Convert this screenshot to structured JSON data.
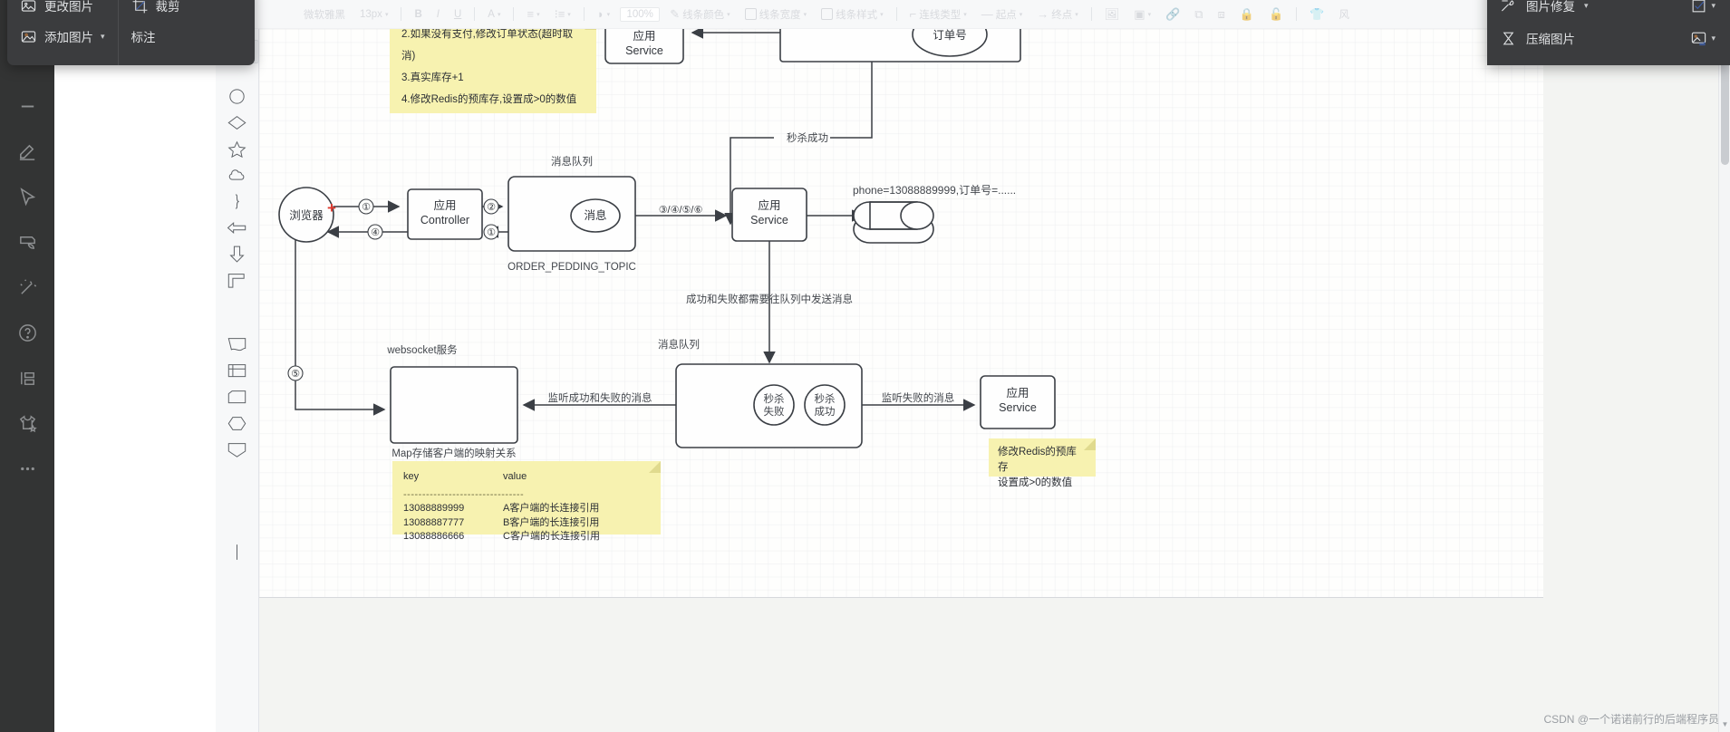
{
  "toolbar": {
    "font_name": "微软雅黑",
    "font_size": "13px",
    "bold": "B",
    "italic": "I",
    "underline": "U",
    "font_color": "A",
    "align": "align-icon",
    "line_spacing": "line-spacing-icon",
    "fill": "fill-icon",
    "zoom": "100%",
    "line_color": "线条颜色",
    "line_width": "线条宽度",
    "line_style": "线条样式",
    "connector_type": "连线类型",
    "start_point": "起点",
    "end_point": "终点",
    "image": "image-icon",
    "image_crop": "image-crop-icon",
    "link": "link-icon",
    "group": "group-icon",
    "ungroup": "ungroup-icon",
    "lock": "lock-icon",
    "unlock": "unlock-icon",
    "tshirt": "tshirt-icon",
    "wind": "风"
  },
  "left_panel": {
    "items": [
      {
        "label": "更改图片",
        "icon": "change-image-icon",
        "caret": false
      },
      {
        "label": "添加图片",
        "icon": "add-image-icon",
        "caret": true
      },
      {
        "label": "裁剪",
        "icon": "crop-icon",
        "caret": false
      },
      {
        "label": "标注",
        "icon": "annotate-icon",
        "caret": false
      }
    ]
  },
  "right_panel": {
    "items": [
      {
        "label": "图片修复",
        "icon": "image-repair-icon",
        "caret": true
      },
      {
        "label": "压缩图片",
        "icon": "compress-image-icon",
        "caret": false
      }
    ],
    "end_icons": [
      {
        "icon": "check-frame-icon",
        "caret": true
      },
      {
        "icon": "image-swap-icon",
        "caret": true
      }
    ]
  },
  "rail": {
    "items": [
      {
        "name": "divider-tool",
        "icon": "minus-icon"
      },
      {
        "name": "pen-tool",
        "icon": "pen-icon"
      },
      {
        "name": "select-tool",
        "icon": "cursor-icon"
      },
      {
        "name": "erase-tool",
        "icon": "mask-icon"
      },
      {
        "name": "magic-tool",
        "icon": "magic-wand-icon"
      },
      {
        "name": "help-tool",
        "icon": "help-circle-icon"
      },
      {
        "name": "layout-tool",
        "icon": "layout-icon"
      },
      {
        "name": "apparel-tool",
        "icon": "tshirt-star-icon"
      },
      {
        "name": "more-tool",
        "icon": "ellipsis-icon"
      }
    ]
  },
  "palette": {
    "search_icon": "search-icon",
    "shapes": [
      "circle-shape",
      "diamond-shape",
      "star-shape",
      "cloud-shape",
      "brace-shape",
      "left-arrow-shape",
      "down-arrow-shape",
      "corner-shape",
      "document-shape",
      "table-shape",
      "rounded-rect-shape",
      "hexagon-shape",
      "pentagon-down-shape",
      "vertical-line-shape"
    ]
  },
  "diagram": {
    "note_top": {
      "lines": [
        "2.如果没有支付,修改订单状态(超时取消)",
        "3.真实库存+1",
        "4.修改Redis的预库存,设置成>0的数值"
      ]
    },
    "note_redis": {
      "lines": [
        "修改Redis的预库存",
        "设置成>0的数值"
      ]
    },
    "note_kv": {
      "header_key": "key",
      "header_value": "value",
      "divider": "--------------------------------",
      "rows": [
        {
          "key": "13088889999",
          "value": "A客户端的长连接引用"
        },
        {
          "key": "13088887777",
          "value": "B客户端的长连接引用"
        },
        {
          "key": "13088886666",
          "value": "C客户端的长连接引用"
        }
      ]
    },
    "nodes": {
      "browser": "浏览器",
      "app_controller_l1": "应用",
      "app_controller_l2": "Controller",
      "mq_top_title": "消息队列",
      "mq_top_caption": "ORDER_PEDDING_TOPIC",
      "message": "消息",
      "app_service_mid_l1": "应用",
      "app_service_mid_l2": "Service",
      "app_service_top_l1": "应用",
      "app_service_top_l2": "Service",
      "order_no": "订单号",
      "websocket_title": "websocket服务",
      "websocket_caption": "Map存储客户端的映射关系",
      "mq_bottom_title": "消息队列",
      "seckill_fail_l1": "秒杀",
      "seckill_fail_l2": "失败",
      "seckill_ok_l1": "秒杀",
      "seckill_ok_l2": "成功",
      "app_service_right_l1": "应用",
      "app_service_right_l2": "Service"
    },
    "edges": {
      "n1": "①",
      "n4": "④",
      "n2": "②",
      "n1b": "①",
      "n3456": "③/④/⑤/⑥",
      "n5": "⑤",
      "seckill_success": "秒杀成功",
      "phone_order": "phone=13088889999,订单号=......",
      "mq_send": "成功和失败都需要往队列中发送消息",
      "listen_both": "监听成功和失败的消息",
      "listen_fail": "监听失败的消息",
      "plus": "+"
    }
  },
  "watermark": "CSDN @一个诺诺前行的后端程序员"
}
